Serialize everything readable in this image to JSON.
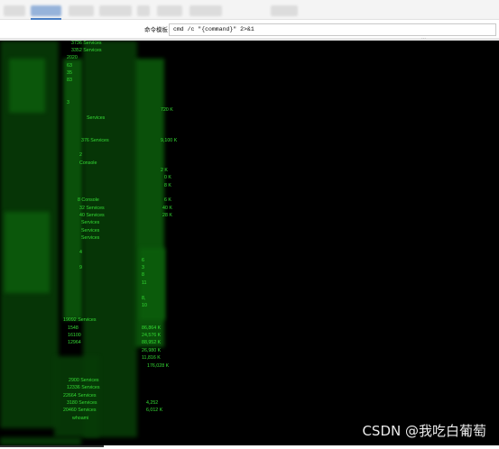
{
  "command_template": {
    "label": "命令模板",
    "value": "cmd /c \"{command}\" 2>&1"
  },
  "terminal": {
    "lines": [
      "3736 Services",
      "3352 Services",
      "2020",
      "63",
      "35",
      "83",
      "3",
      "720 K",
      "Services",
      "376 Services",
      "9,100 K",
      "2",
      "Console",
      "2 K",
      "0 K",
      "8 K",
      "8 Console",
      "6 K",
      "32 Services",
      "40 K",
      "40 Services",
      "28 K",
      "Services",
      "Services",
      "Services",
      "4",
      "9",
      "6",
      "3",
      "8",
      "11",
      "8,",
      "10",
      "19092 Services",
      "1548",
      "86,864 K",
      "16100",
      "24,576 K",
      "12964",
      "88,952 K",
      "26,980 K",
      "11,816 K",
      "176,028 K",
      "2900 Services",
      "12336 Services",
      "22664 Services",
      "3180 Services",
      "4,252",
      "20460 Services",
      "6,012 K",
      "whoami"
    ]
  },
  "watermark": "CSDN @我吃白葡萄"
}
